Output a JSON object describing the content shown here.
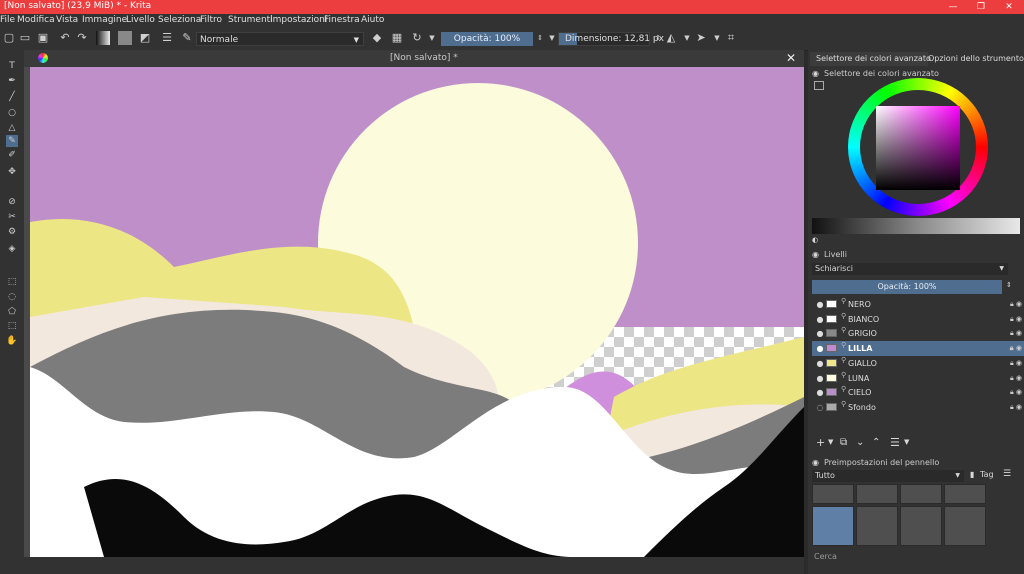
{
  "window": {
    "title": "[Non salvato]  (23,9 MiB)  * - Krita",
    "controls": [
      "—",
      "❐",
      "✕"
    ]
  },
  "menu": [
    "File",
    "Modifica",
    "Vista",
    "Immagine",
    "Livello",
    "Seleziona",
    "Filtro",
    "Strumenti",
    "Impostazioni",
    "Finestra",
    "Aiuto"
  ],
  "toolbar": {
    "blend_mode": "Normale",
    "opacity_label": "Opacità: 100%",
    "size_label": "Dimensione: 12,81 px"
  },
  "canvas": {
    "tab_title": "[Non salvato]  *",
    "close": "✕"
  },
  "dock": {
    "tabs": [
      "Selettore dei colori avanzato",
      "Opzioni dello strumento"
    ],
    "color_panel_title": "Selettore dei colori avanzato",
    "layers_title": "Livelli",
    "layer_blend": "Schiarisci",
    "layer_opacity": "Opacità:  100%",
    "layers": [
      {
        "name": "NERO",
        "thumb": "#ffffff",
        "selected": false
      },
      {
        "name": "BIANCO",
        "thumb": "#ffffff",
        "selected": false
      },
      {
        "name": "GRIGIO",
        "thumb": "#888888",
        "selected": false
      },
      {
        "name": "LILLA",
        "thumb": "#c08ad0",
        "selected": true
      },
      {
        "name": "GIALLO",
        "thumb": "#efe68a",
        "selected": false
      },
      {
        "name": "LUNA",
        "thumb": "#fdfbe0",
        "selected": false
      },
      {
        "name": "CIELO",
        "thumb": "#b98fc8",
        "selected": false
      },
      {
        "name": "Sfondo",
        "thumb": "#aaaaaa",
        "selected": false
      }
    ],
    "brush_presets_title": "Preimpostazioni del pennello",
    "brush_filter": "Tutto",
    "brush_tag_label": "Tag",
    "search_placeholder": "Cerca"
  },
  "colors": {
    "sky": "#bf8fc9",
    "moon": "#fcfbdc",
    "yellow": "#ede685",
    "cream": "#f3e8de",
    "gray": "#7c7c7c",
    "white": "#ffffff",
    "black": "#0a0a0a",
    "lilac": "#d08fdc",
    "accent": "#4e6d8f",
    "titlebar": "#ec3d3f"
  }
}
